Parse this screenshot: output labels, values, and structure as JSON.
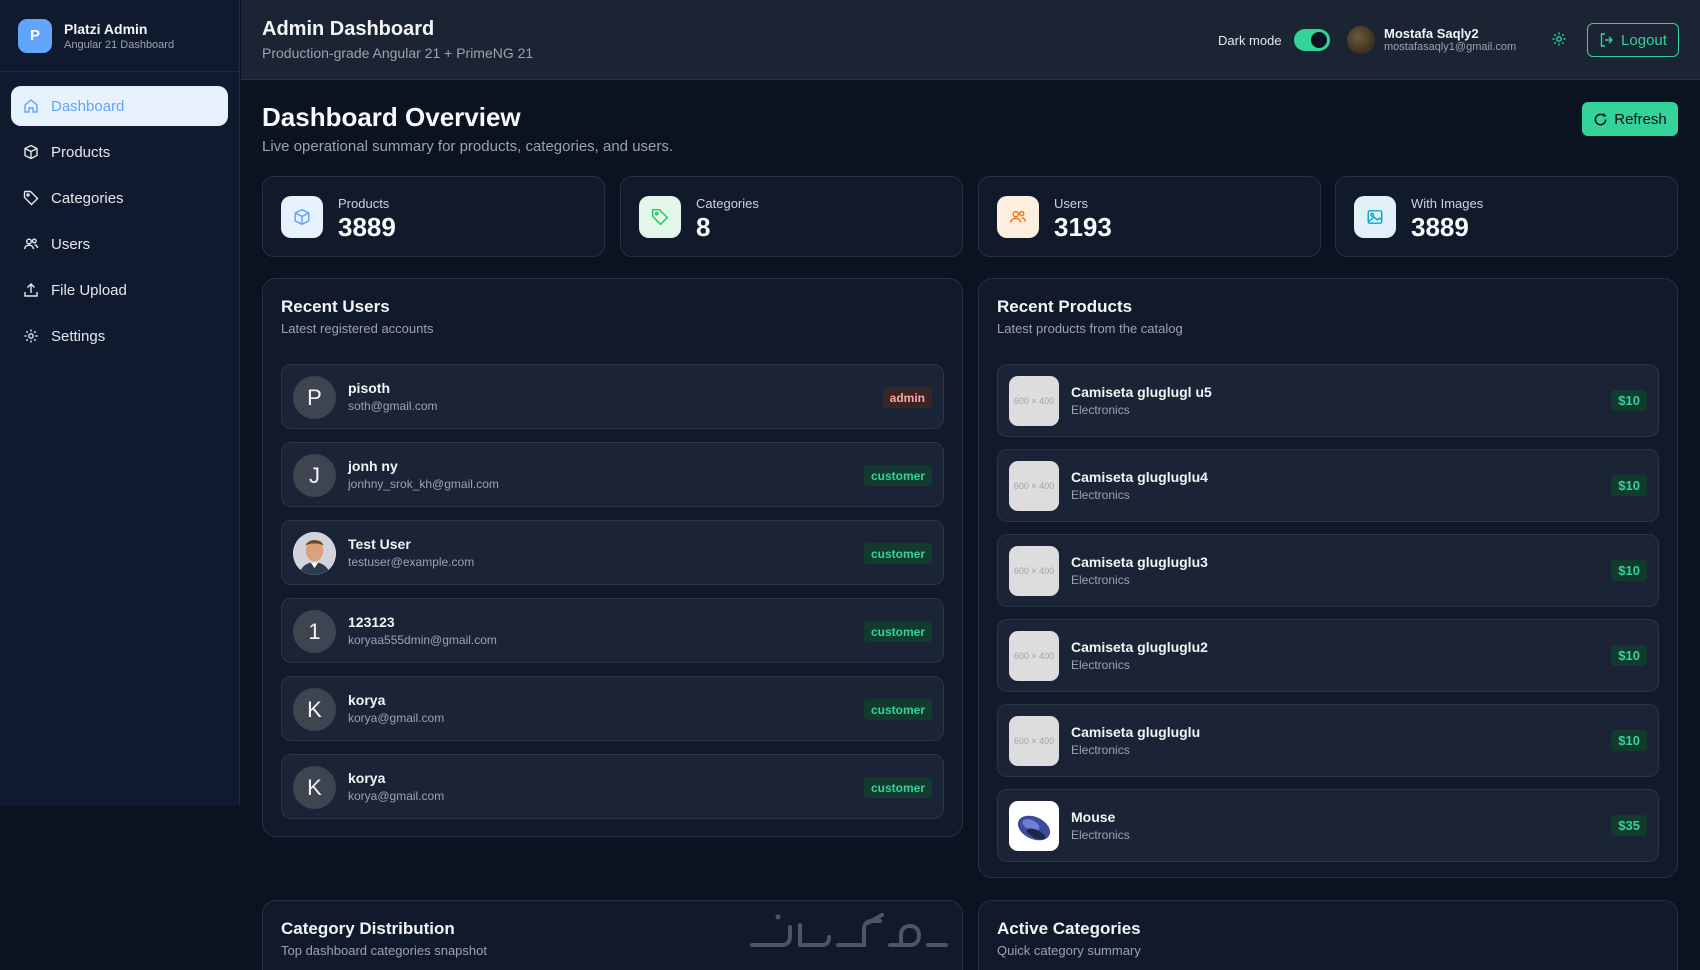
{
  "brand": {
    "logo_letter": "P",
    "title": "Platzi Admin",
    "subtitle": "Angular 21 Dashboard"
  },
  "sidebar": {
    "items": [
      {
        "label": "Dashboard",
        "icon": "home-icon",
        "active": true
      },
      {
        "label": "Products",
        "icon": "box-icon"
      },
      {
        "label": "Categories",
        "icon": "tag-icon"
      },
      {
        "label": "Users",
        "icon": "users-icon"
      },
      {
        "label": "File Upload",
        "icon": "upload-icon"
      },
      {
        "label": "Settings",
        "icon": "gear-icon"
      }
    ]
  },
  "header": {
    "title": "Admin Dashboard",
    "subtitle": "Production-grade Angular 21 + PrimeNG 21",
    "dark_mode_label": "Dark mode",
    "dark_mode_on": true,
    "user_name": "Mostafa Saqly2",
    "user_email": "mostafasaqly1@gmail.com",
    "logout_label": "Logout"
  },
  "main": {
    "title": "Dashboard Overview",
    "subtitle": "Live operational summary for products, categories, and users.",
    "refresh_label": "Refresh"
  },
  "stats": [
    {
      "label": "Products",
      "value": "3889",
      "icon": "box-icon",
      "color": "#60a5fa",
      "bg": "#e8f2fd"
    },
    {
      "label": "Categories",
      "value": "8",
      "icon": "tag-icon",
      "color": "#22c55e",
      "bg": "#e3f6ea"
    },
    {
      "label": "Users",
      "value": "3193",
      "icon": "users-icon",
      "color": "#f97316",
      "bg": "#fdeede"
    },
    {
      "label": "With Images",
      "value": "3889",
      "icon": "image-icon",
      "color": "#0ea5c6",
      "bg": "#e0f2f8"
    }
  ],
  "recent_users": {
    "title": "Recent Users",
    "subtitle": "Latest registered accounts",
    "rows": [
      {
        "initial": "P",
        "name": "pisoth",
        "email": "soth@gmail.com",
        "role": "admin"
      },
      {
        "initial": "J",
        "name": "jonh ny",
        "email": "jonhny_srok_kh@gmail.com",
        "role": "customer"
      },
      {
        "initial": "",
        "name": "Test User",
        "email": "testuser@example.com",
        "role": "customer",
        "photo": true
      },
      {
        "initial": "1",
        "name": "123123",
        "email": "koryaa555dmin@gmail.com",
        "role": "customer"
      },
      {
        "initial": "K",
        "name": "korya",
        "email": "korya@gmail.com",
        "role": "customer"
      },
      {
        "initial": "K",
        "name": "korya",
        "email": "korya@gmail.com",
        "role": "customer"
      }
    ]
  },
  "recent_products": {
    "title": "Recent Products",
    "subtitle": "Latest products from the catalog",
    "placeholder_text": "600 × 400",
    "rows": [
      {
        "name": "Camiseta gluglugl u5",
        "category": "Electronics",
        "price": "$10"
      },
      {
        "name": "Camiseta glugluglu4",
        "category": "Electronics",
        "price": "$10"
      },
      {
        "name": "Camiseta glugluglu3",
        "category": "Electronics",
        "price": "$10"
      },
      {
        "name": "Camiseta glugluglu2",
        "category": "Electronics",
        "price": "$10"
      },
      {
        "name": "Camiseta glugluglu",
        "category": "Electronics",
        "price": "$10"
      },
      {
        "name": "Mouse",
        "category": "Electronics",
        "price": "$35",
        "image": "mouse"
      }
    ]
  },
  "category_distribution": {
    "title": "Category Distribution",
    "subtitle": "Top dashboard categories snapshot"
  },
  "active_categories": {
    "title": "Active Categories",
    "subtitle": "Quick category summary"
  },
  "watermark": "خمسات"
}
